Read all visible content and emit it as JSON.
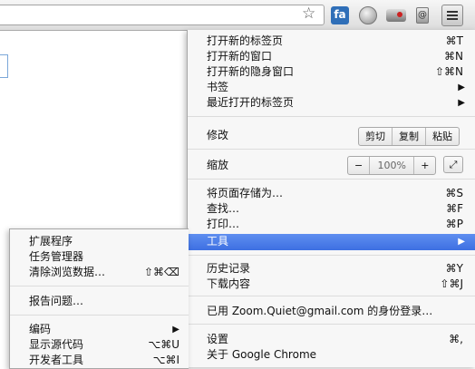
{
  "toolbar": {
    "star_icon": "bookmark-star-icon",
    "ext_fa_label": "fa",
    "menu_icon": "hamburger-menu-icon"
  },
  "main_menu": {
    "new_tab": {
      "label": "打开新的标签页",
      "shortcut": "⌘T"
    },
    "new_window": {
      "label": "打开新的窗口",
      "shortcut": "⌘N"
    },
    "new_incognito": {
      "label": "打开新的隐身窗口",
      "shortcut": "⇧⌘N"
    },
    "bookmarks": {
      "label": "书签"
    },
    "recent_tabs": {
      "label": "最近打开的标签页"
    },
    "edit": {
      "label": "修改",
      "cut": "剪切",
      "copy": "复制",
      "paste": "粘贴"
    },
    "zoom": {
      "label": "缩放",
      "minus": "−",
      "value": "100%",
      "plus": "+"
    },
    "save_page": {
      "label": "将页面存储为…",
      "shortcut": "⌘S"
    },
    "find": {
      "label": "查找…",
      "shortcut": "⌘F"
    },
    "print": {
      "label": "打印…",
      "shortcut": "⌘P"
    },
    "tools": {
      "label": "工具"
    },
    "history": {
      "label": "历史记录",
      "shortcut": "⌘Y"
    },
    "downloads": {
      "label": "下载内容",
      "shortcut": "⇧⌘J"
    },
    "signed_in": {
      "label": "已用 Zoom.Quiet@gmail.com 的身份登录…"
    },
    "settings": {
      "label": "设置",
      "shortcut": "⌘,"
    },
    "about": {
      "label": "关于 Google Chrome"
    }
  },
  "tools_menu": {
    "extensions": {
      "label": "扩展程序"
    },
    "task_manager": {
      "label": "任务管理器"
    },
    "clear_data": {
      "label": "清除浏览数据…",
      "shortcut": "⇧⌘⌫"
    },
    "report_issue": {
      "label": "报告问题…"
    },
    "encoding": {
      "label": "编码"
    },
    "view_source": {
      "label": "显示源代码",
      "shortcut": "⌥⌘U"
    },
    "dev_tools": {
      "label": "开发者工具",
      "shortcut": "⌥⌘I"
    }
  },
  "colors": {
    "highlight": "#3d6fe2"
  }
}
